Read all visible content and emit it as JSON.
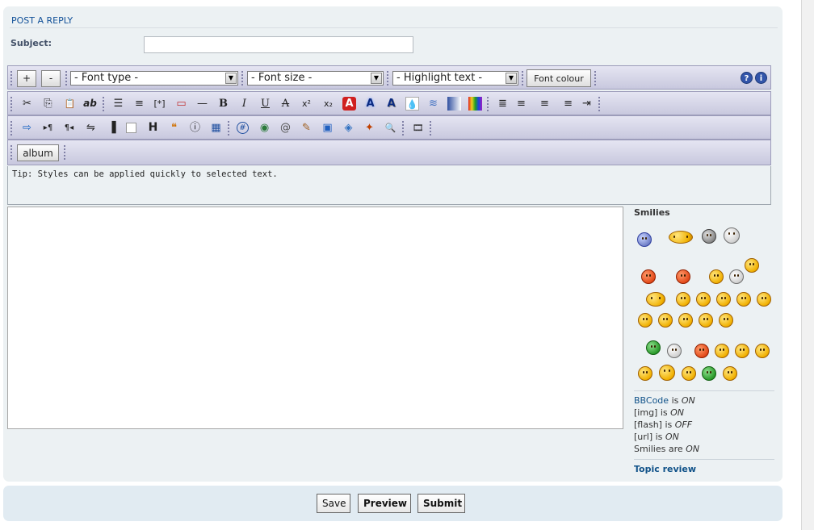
{
  "heading": "POST A REPLY",
  "subject_label": "Subject:",
  "subject_value": "",
  "toolbar1": {
    "plus_label": "+",
    "minus_label": "-",
    "font_type": "- Font type -",
    "font_size": "- Font size -",
    "highlight_text": "- Highlight text -",
    "font_colour": "Font colour",
    "help_icon_glyph": "?",
    "info_icon_glyph": "i"
  },
  "toolbar2_icons": [
    {
      "name": "cut-icon",
      "glyph": "✂"
    },
    {
      "name": "copy-icon",
      "glyph": "⎘"
    },
    {
      "name": "paste-icon",
      "glyph": "📋"
    },
    {
      "name": "spellcheck-icon",
      "glyph": "ab"
    },
    {
      "name": "bullet-list-icon",
      "glyph": "☰"
    },
    {
      "name": "numbered-list-icon",
      "glyph": "≡"
    },
    {
      "name": "list-item-icon",
      "glyph": "[*]"
    },
    {
      "name": "quote-box-icon",
      "glyph": "▭"
    },
    {
      "name": "horizontal-rule-icon",
      "glyph": "—"
    },
    {
      "name": "bold-icon",
      "glyph": "B"
    },
    {
      "name": "italic-icon",
      "glyph": "I"
    },
    {
      "name": "underline-icon",
      "glyph": "U"
    },
    {
      "name": "strikethrough-icon",
      "glyph": "A"
    },
    {
      "name": "superscript-icon",
      "glyph": "x²"
    },
    {
      "name": "subscript-icon",
      "glyph": "x₂"
    },
    {
      "name": "text-outline-icon",
      "glyph": "A"
    },
    {
      "name": "text-glow-icon",
      "glyph": "A"
    },
    {
      "name": "text-shadow-icon",
      "glyph": "A"
    },
    {
      "name": "transparency-icon",
      "glyph": "💧"
    },
    {
      "name": "wave-icon",
      "glyph": "≋"
    },
    {
      "name": "gradient-icon",
      "glyph": "▤"
    },
    {
      "name": "rainbow-icon",
      "glyph": "▥"
    },
    {
      "name": "justify-icon",
      "glyph": "≣"
    },
    {
      "name": "align-left-icon",
      "glyph": "≡"
    },
    {
      "name": "align-center-icon",
      "glyph": "≡"
    },
    {
      "name": "align-right-icon",
      "glyph": "≡"
    },
    {
      "name": "indent-icon",
      "glyph": "⇥"
    }
  ],
  "toolbar3_icons": [
    {
      "name": "marquee-icon",
      "glyph": "⇨"
    },
    {
      "name": "ltr-icon",
      "glyph": "▸¶"
    },
    {
      "name": "rtl-icon",
      "glyph": "¶◂"
    },
    {
      "name": "offtopic-icon",
      "glyph": "⇋"
    },
    {
      "name": "sidebar-icon",
      "glyph": "▐"
    },
    {
      "name": "spoiler-icon",
      "glyph": "□"
    },
    {
      "name": "heading-icon",
      "glyph": "H"
    },
    {
      "name": "quote-icon",
      "glyph": "❝"
    },
    {
      "name": "info-box-icon",
      "glyph": "ⓘ"
    },
    {
      "name": "table-icon",
      "glyph": "▦"
    },
    {
      "name": "anchor-icon",
      "glyph": "#"
    },
    {
      "name": "web-icon",
      "glyph": "◉"
    },
    {
      "name": "email-icon",
      "glyph": "@"
    },
    {
      "name": "attachment-icon",
      "glyph": "✎"
    },
    {
      "name": "image-icon",
      "glyph": "▣"
    },
    {
      "name": "flash-icon",
      "glyph": "◈"
    },
    {
      "name": "mark-icon",
      "glyph": "✦"
    },
    {
      "name": "zoom-icon",
      "glyph": "🔍"
    },
    {
      "name": "video-icon",
      "glyph": "🎞"
    }
  ],
  "album_label": "album",
  "tip": "Tip: Styles can be applied quickly to selected text.",
  "smilies_title": "Smilies",
  "options": {
    "bbcode_link": "BBCode",
    "bbcode_state": "ON",
    "img_label": "[img] is",
    "img_state": "ON",
    "flash_label": "[flash] is",
    "flash_state": "OFF",
    "url_label": "[url] is",
    "url_state": "ON",
    "smilies_label": "Smilies are",
    "smilies_state": "ON",
    "is_word": "is"
  },
  "topic_review": "Topic review",
  "buttons": {
    "save": "Save",
    "preview": "Preview",
    "submit": "Submit"
  },
  "colors": {
    "panel_bg": "#ECF1F3",
    "link": "#105289",
    "toolbar_gradient_top": "#E5E5F2",
    "toolbar_gradient_bottom": "#C8C8DE"
  }
}
